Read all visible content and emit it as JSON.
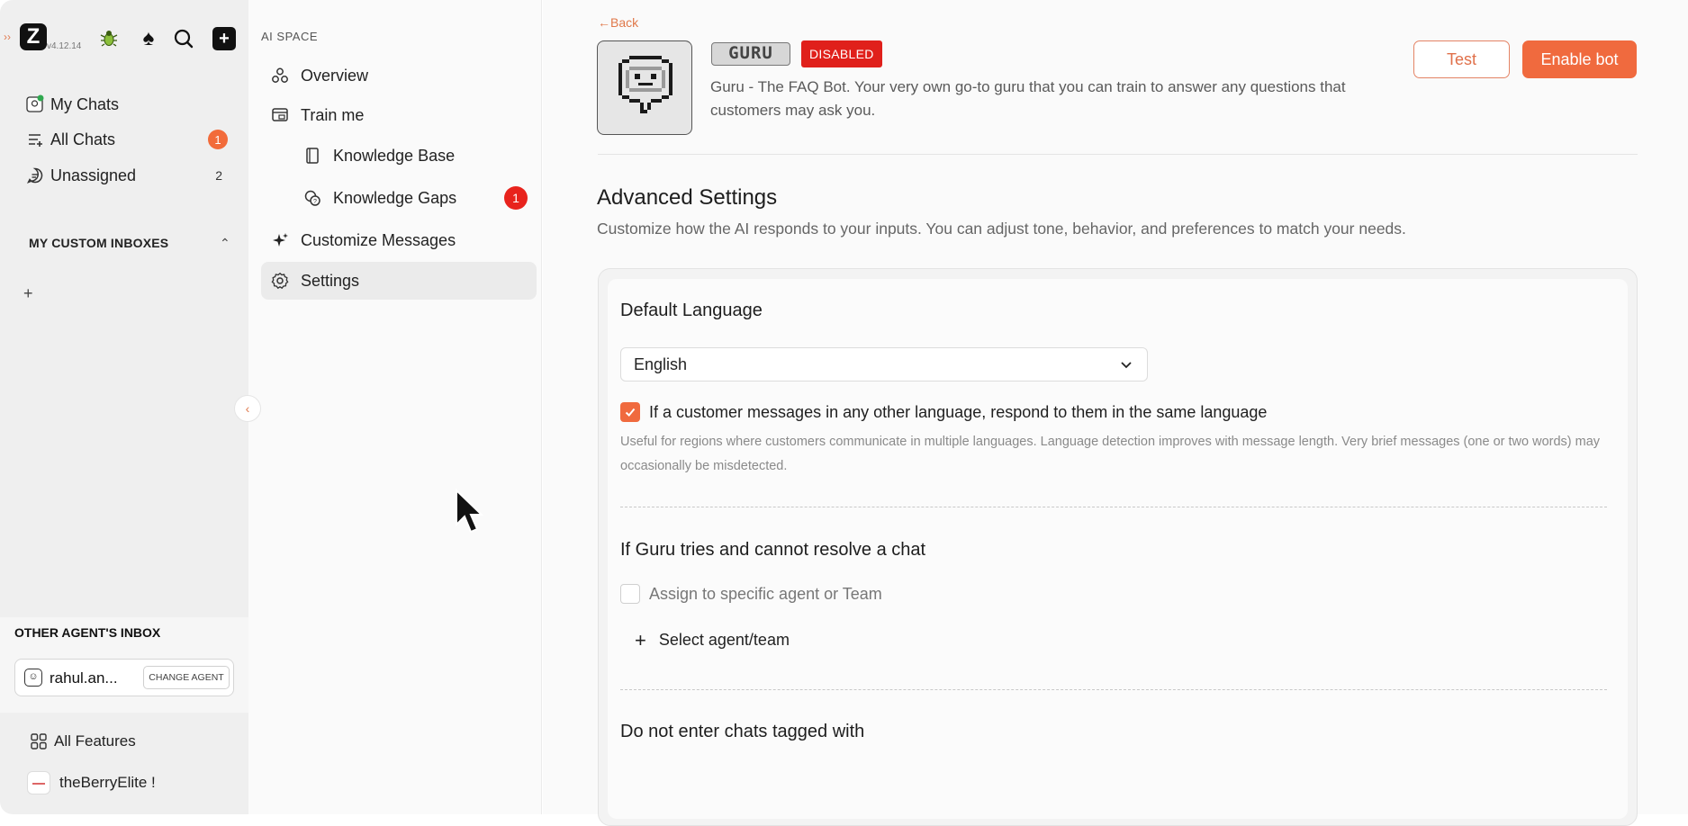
{
  "rail": {
    "logo_letter": "Z",
    "version": "v4.12.14",
    "nav": [
      {
        "label": "My Chats",
        "count": ""
      },
      {
        "label": "All Chats",
        "count": "1"
      },
      {
        "label": "Unassigned",
        "count": "2"
      }
    ],
    "custom_inboxes_title": "MY CUSTOM INBOXES",
    "add_label": "+",
    "other_agents_title": "OTHER AGENT'S INBOX",
    "agent_name": "rahul.an...",
    "change_agent_label": "CHANGE AGENT",
    "all_features_label": "All Features",
    "org_name": "theBerryElite !"
  },
  "subnav": {
    "header": "AI SPACE",
    "items": [
      {
        "label": "Overview"
      },
      {
        "label": "Train me"
      },
      {
        "label": "Knowledge Base"
      },
      {
        "label": "Knowledge Gaps",
        "badge": "1"
      },
      {
        "label": "Customize Messages"
      },
      {
        "label": "Settings"
      }
    ]
  },
  "bot": {
    "back_label": "Back",
    "name": "GURU",
    "status_badge": "DISABLED",
    "description": "Guru - The FAQ Bot. Your very own go-to guru that you can train to answer any questions that customers may ask you.",
    "test_label": "Test",
    "enable_label": "Enable bot"
  },
  "advanced": {
    "title": "Advanced Settings",
    "description": "Customize how the AI responds to your inputs. You can adjust tone, behavior, and preferences to match your needs.",
    "default_language": {
      "title": "Default Language",
      "selected": "English",
      "checkbox_label": "If a customer messages in any other language, respond to them in the same language",
      "checked": true,
      "help": "Useful for regions where customers communicate in multiple languages. Language detection improves with message length. Very brief messages (one or two words) may occasionally be misdetected."
    },
    "unresolved": {
      "title": "If Guru tries and cannot resolve a chat",
      "checkbox_label": "Assign to specific agent or Team",
      "checked": false,
      "select_label": "Select agent/team"
    },
    "tagged": {
      "title": "Do not enter chats tagged with"
    }
  },
  "colors": {
    "accent": "#f06a3e",
    "danger": "#e0201b",
    "rail_bg": "#efefef"
  }
}
